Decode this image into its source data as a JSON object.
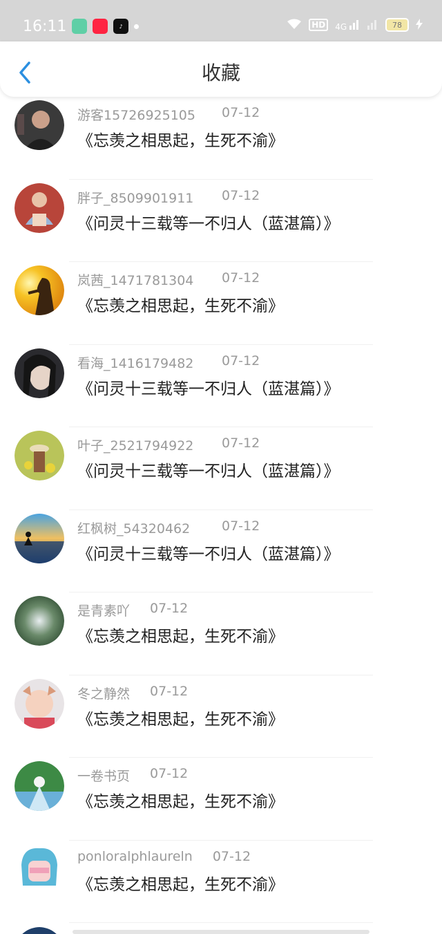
{
  "statusbar": {
    "time": "16:11",
    "battery": "78",
    "net": "4G",
    "hd": "HD"
  },
  "header": {
    "title": "收藏"
  },
  "items": [
    {
      "user": "游客15726925105",
      "date": "07-12",
      "title": "《忘羡之相思起，生死不渝》"
    },
    {
      "user": "胖子_8509901911",
      "date": "07-12",
      "title": "《问灵十三载等一不归人（蓝湛篇）》"
    },
    {
      "user": "岚茜_1471781304",
      "date": "07-12",
      "title": "《忘羡之相思起，生死不渝》"
    },
    {
      "user": "看海_1416179482",
      "date": "07-12",
      "title": "《问灵十三载等一不归人（蓝湛篇）》"
    },
    {
      "user": "叶子_2521794922",
      "date": "07-12",
      "title": "《问灵十三载等一不归人（蓝湛篇）》"
    },
    {
      "user": "红枫树_54320462",
      "date": "07-12",
      "title": "《问灵十三载等一不归人（蓝湛篇）》"
    },
    {
      "user": "是青素吖",
      "date": "07-12",
      "title": "《忘羡之相思起，生死不渝》"
    },
    {
      "user": "冬之静然",
      "date": "07-12",
      "title": "《忘羡之相思起，生死不渝》"
    },
    {
      "user": "一卷书页",
      "date": "07-12",
      "title": "《忘羡之相思起，生死不渝》"
    },
    {
      "user": "ponloralphlaureln",
      "date": "07-12",
      "title": "《忘羡之相思起，生死不渝》"
    }
  ],
  "colors": {
    "accent": "#2b8fe0",
    "text": "#222222",
    "muted": "#9a9a9a"
  }
}
